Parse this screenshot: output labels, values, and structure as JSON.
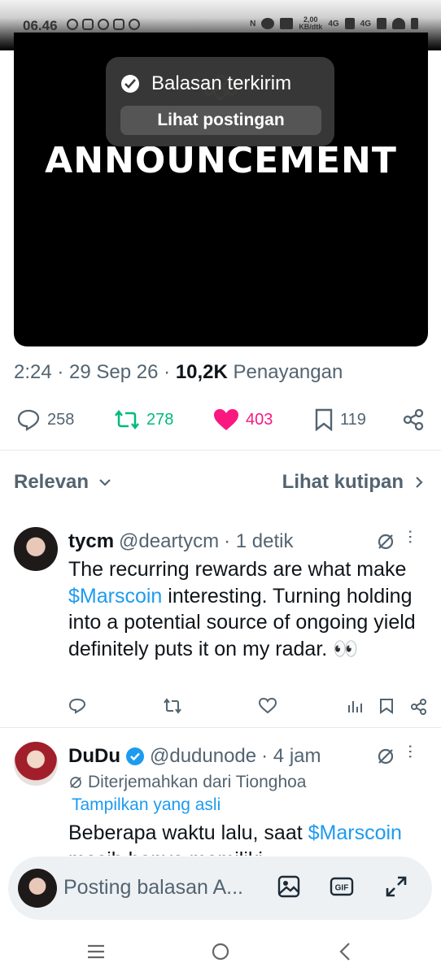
{
  "status": {
    "time": "06.46",
    "netspeed": "2,00\nKB/dtk",
    "net1": "4G",
    "net2": "4G"
  },
  "media": {
    "headline": "ANNOUNCEMENT"
  },
  "toast": {
    "message": "Balasan terkirim",
    "button": "Lihat postingan"
  },
  "meta": {
    "time": "2:24",
    "date": "29 Sep 26",
    "views": "10,2K",
    "views_label": "Penayangan"
  },
  "actions": {
    "replies": "258",
    "reposts": "278",
    "likes": "403",
    "bookmarks": "119"
  },
  "sort": {
    "left": "Relevan",
    "right": "Lihat kutipan"
  },
  "posts": [
    {
      "name": "tycm",
      "handle": "@deartycm",
      "time": "· 1 detik",
      "text_pre": "The recurring rewards are what make ",
      "cashtag": "$Marscoin",
      "text_post": " interesting. Turning holding into a potential source of ongoing yield definitely puts it on my radar. 👀"
    },
    {
      "name": "DuDu",
      "handle": "@dudunode",
      "time": "· 4 jam",
      "translated": "Diterjemahkan dari Tionghoa",
      "show_original": "Tampilkan yang asli",
      "text_pre": "Beberapa waktu lalu, saat ",
      "cashtag": "$Marscoin",
      "text_post": " masih hanya memiliki"
    }
  ],
  "composer": {
    "placeholder": "Posting balasan A..."
  },
  "colors": {
    "accent": "#1d9bf0",
    "repost": "#00ba7c",
    "like": "#f91880",
    "muted": "#536471"
  }
}
